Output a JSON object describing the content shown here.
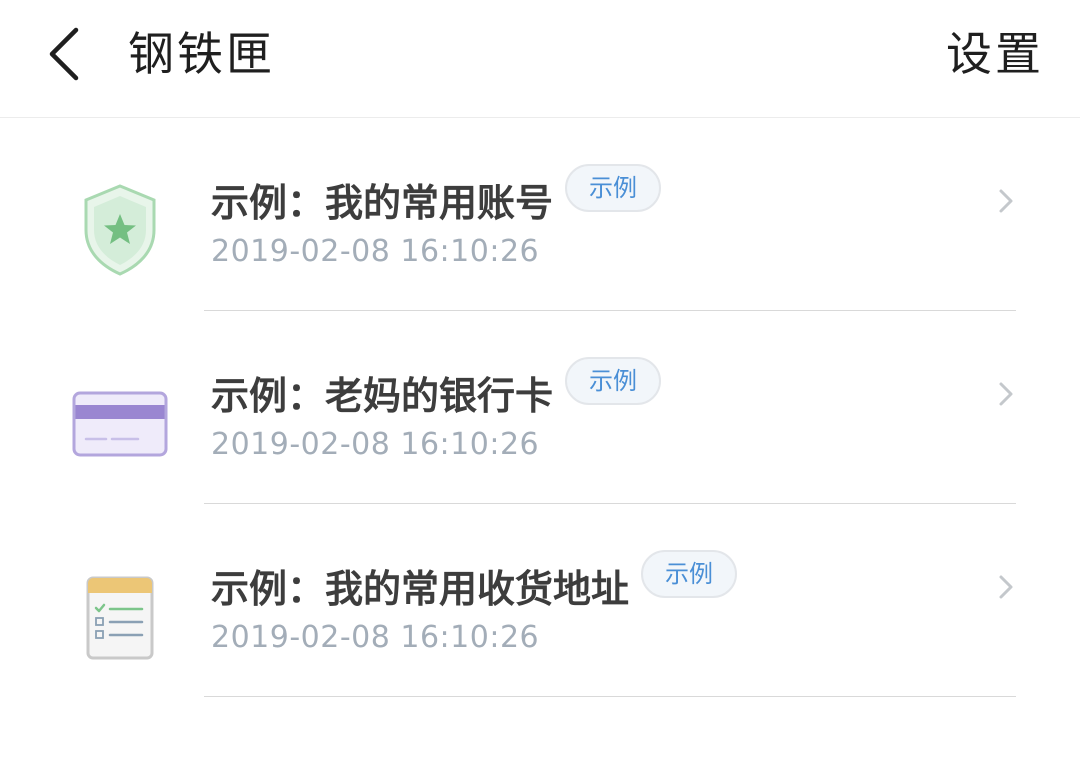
{
  "header": {
    "back_icon": "chevron-left-icon",
    "title": "钢铁匣",
    "settings_label": "设置"
  },
  "items": [
    {
      "title": "示例：我的常用账号",
      "tag": "示例",
      "time": "2019-02-08 16:10:26",
      "icon": "shield-star-icon",
      "icon_color": "#7cc58a"
    },
    {
      "title": "示例：老妈的银行卡",
      "tag": "示例",
      "time": "2019-02-08 16:10:26",
      "icon": "bank-card-icon",
      "icon_color": "#9a86d1"
    },
    {
      "title": "示例：我的常用收货地址",
      "tag": "示例",
      "time": "2019-02-08 16:10:26",
      "icon": "checklist-note-icon",
      "icon_color": "#e6c46e"
    }
  ],
  "colors": {
    "tag_text": "#4a8fd6",
    "time_text": "#a3adb8",
    "title_text": "#3d3d3d"
  }
}
